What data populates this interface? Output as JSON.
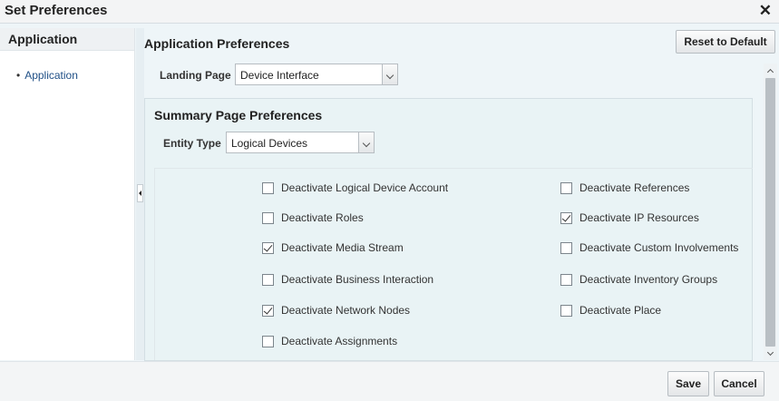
{
  "dialog": {
    "title": "Set Preferences",
    "close_icon": "close-icon"
  },
  "sidebar": {
    "heading": "Application",
    "items": [
      {
        "label": "Application"
      }
    ]
  },
  "main": {
    "title": "Application Preferences",
    "reset_label": "Reset to Default",
    "landing_page": {
      "label": "Landing Page",
      "value": "Device Interface"
    }
  },
  "summary": {
    "title": "Summary Page Preferences",
    "entity_type": {
      "label": "Entity Type",
      "value": "Logical Devices"
    },
    "options_left": [
      {
        "label": "Deactivate Logical Device Account",
        "checked": false
      },
      {
        "label": "Deactivate Roles",
        "checked": false
      },
      {
        "label": "Deactivate Media Stream",
        "checked": true
      },
      {
        "label": "Deactivate Business Interaction",
        "checked": false
      },
      {
        "label": "Deactivate Network Nodes",
        "checked": true
      },
      {
        "label": "Deactivate Assignments",
        "checked": false
      }
    ],
    "options_right": [
      {
        "label": "Deactivate References",
        "checked": false
      },
      {
        "label": "Deactivate IP Resources",
        "checked": true
      },
      {
        "label": "Deactivate Custom Involvements",
        "checked": false
      },
      {
        "label": "Deactivate Inventory Groups",
        "checked": false
      },
      {
        "label": "Deactivate Place",
        "checked": false
      }
    ]
  },
  "footer": {
    "save_label": "Save",
    "cancel_label": "Cancel"
  }
}
